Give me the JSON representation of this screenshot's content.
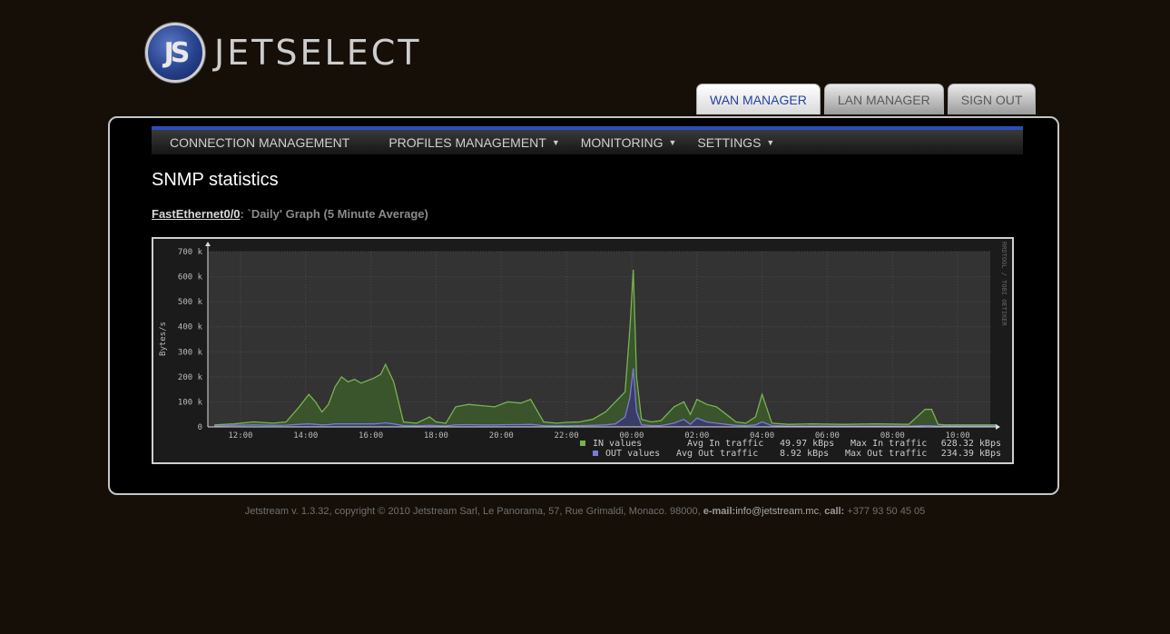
{
  "logo": {
    "mark": "JS",
    "text": "JETSELECT"
  },
  "top_tabs": [
    {
      "label": "WAN MANAGER",
      "active": true
    },
    {
      "label": "LAN MANAGER",
      "active": false
    },
    {
      "label": "SIGN OUT",
      "active": false
    }
  ],
  "menu": [
    {
      "label": "CONNECTION MANAGEMENT",
      "dropdown": false
    },
    {
      "label": "PROFILES MANAGEMENT",
      "dropdown": true
    },
    {
      "label": "MONITORING",
      "dropdown": true
    },
    {
      "label": "SETTINGS",
      "dropdown": true
    }
  ],
  "page_title": "SNMP statistics",
  "subtitle": {
    "interface": "FastEthernet0/0",
    "rest": ": `Daily' Graph (5 Minute Average)"
  },
  "chart_data": {
    "type": "area",
    "ylabel": "Bytes/s",
    "side_label": "RRDTOOL / TOBI OETIKER",
    "y_ticks": [
      "0",
      "100 k",
      "200 k",
      "300 k",
      "400 k",
      "500 k",
      "600 k",
      "700 k"
    ],
    "ylim": [
      0,
      700000
    ],
    "x_ticks": [
      "12:00",
      "14:00",
      "16:00",
      "18:00",
      "20:00",
      "22:00",
      "00:00",
      "02:00",
      "04:00",
      "06:00",
      "08:00",
      "10:00"
    ],
    "x_hours": [
      11.2,
      11.8,
      12.4,
      13.0,
      13.4,
      13.8,
      14.1,
      14.3,
      14.5,
      14.7,
      14.9,
      15.1,
      15.3,
      15.5,
      15.7,
      15.9,
      16.1,
      16.3,
      16.45,
      16.7,
      17.0,
      17.4,
      17.8,
      18.0,
      18.3,
      18.6,
      19.0,
      19.4,
      19.8,
      20.2,
      20.6,
      20.9,
      21.3,
      21.7,
      22.0,
      22.4,
      22.8,
      23.2,
      23.5,
      23.8,
      23.95,
      24.05,
      24.15,
      24.3,
      24.6,
      24.9,
      25.3,
      25.6,
      25.8,
      26.0,
      26.3,
      26.6,
      26.9,
      27.2,
      27.5,
      27.8,
      28.0,
      28.3,
      28.8,
      29.5,
      30.5,
      31.5,
      32.5,
      33.0,
      33.2,
      33.4,
      33.6,
      34.0,
      34.5,
      35.0,
      35.2
    ],
    "series": [
      {
        "name": "IN values",
        "color": "#79b34f",
        "values": [
          8000,
          12000,
          20000,
          15000,
          20000,
          80000,
          130000,
          100000,
          60000,
          90000,
          160000,
          200000,
          180000,
          190000,
          175000,
          185000,
          195000,
          210000,
          250000,
          180000,
          20000,
          15000,
          40000,
          20000,
          15000,
          80000,
          90000,
          85000,
          80000,
          100000,
          95000,
          110000,
          20000,
          15000,
          18000,
          20000,
          30000,
          60000,
          100000,
          140000,
          400000,
          628000,
          200000,
          30000,
          20000,
          25000,
          80000,
          100000,
          50000,
          110000,
          90000,
          80000,
          50000,
          20000,
          15000,
          40000,
          130000,
          15000,
          10000,
          12000,
          10000,
          12000,
          10000,
          70000,
          70000,
          10000,
          8000,
          8000,
          8000,
          8000,
          8000
        ]
      },
      {
        "name": "OUT values",
        "color": "#7a7ad8",
        "values": [
          4000,
          6000,
          8000,
          6000,
          7000,
          10000,
          12000,
          10000,
          8000,
          9000,
          12000,
          12000,
          12000,
          12000,
          12000,
          12000,
          12000,
          14000,
          16000,
          12000,
          5000,
          4000,
          6000,
          5000,
          4000,
          8000,
          9000,
          8000,
          8000,
          9000,
          9000,
          10000,
          5000,
          4000,
          4000,
          5000,
          6000,
          8000,
          12000,
          40000,
          120000,
          234000,
          60000,
          8000,
          5000,
          5000,
          15000,
          30000,
          10000,
          35000,
          20000,
          15000,
          10000,
          6000,
          5000,
          8000,
          20000,
          5000,
          3000,
          3000,
          3000,
          3000,
          3000,
          5000,
          5000,
          3000,
          3000,
          3000,
          3000,
          3000,
          3000
        ]
      }
    ],
    "legend": [
      {
        "swatch": "#79b34f",
        "name": "IN values",
        "avg_label": "Avg In traffic",
        "avg": "49.97 kBps",
        "max_label": "Max In traffic",
        "max": "628.32 kBps"
      },
      {
        "swatch": "#7a7ad8",
        "name": "OUT values",
        "avg_label": "Avg Out traffic",
        "avg": "8.92 kBps",
        "max_label": "Max Out traffic",
        "max": "234.39 kBps"
      }
    ],
    "grid": true
  },
  "footer": {
    "text": "Jetstream v. 1.3.32, copyright © 2010 Jetstream Sarl, Le Panorama, 57, Rue Grimaldi, Monaco. 98000,",
    "email_label": "e-mail:",
    "email": "info@jetstream.mc",
    "call_label": "call:",
    "phone": "+377 93 50 45 05"
  }
}
